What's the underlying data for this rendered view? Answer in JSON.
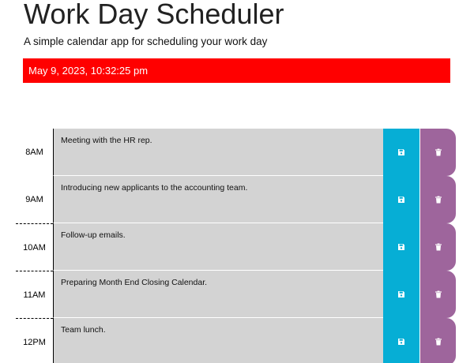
{
  "header": {
    "title": "Work Day Scheduler",
    "subtitle": "A simple calendar app for scheduling your work day"
  },
  "current_date": "May 9, 2023, 10:32:25 pm",
  "colors": {
    "date_bar": "#ff0000",
    "past_row": "#d3d3d3",
    "save_button": "#06aed5",
    "delete_button": "#9e659c"
  },
  "icons": {
    "save": "floppy-disk-icon",
    "delete": "trash-icon"
  },
  "time_blocks": [
    {
      "hour": "8AM",
      "description": "Meeting with the HR rep."
    },
    {
      "hour": "9AM",
      "description": "Introducing new applicants to the accounting team."
    },
    {
      "hour": "10AM",
      "description": "Follow-up emails."
    },
    {
      "hour": "11AM",
      "description": "Preparing Month End Closing Calendar."
    },
    {
      "hour": "12PM",
      "description": "Team lunch."
    }
  ]
}
